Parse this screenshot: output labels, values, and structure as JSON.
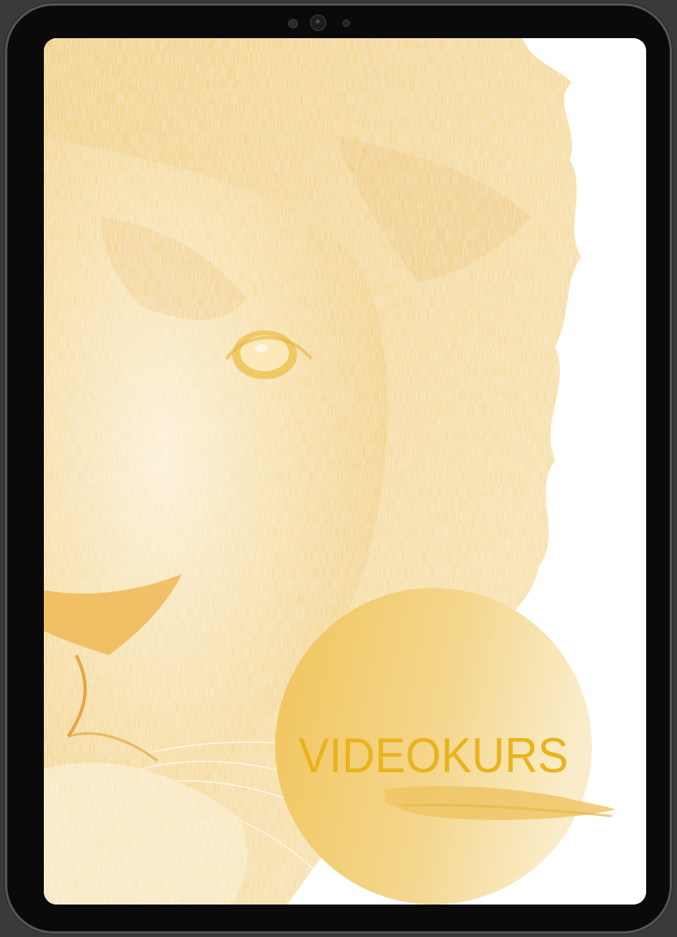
{
  "screen": {
    "badge_label": "VIDEOKURS"
  },
  "colors": {
    "accent": "#e9b31d",
    "lion_tint": "#f3cf76",
    "badge_gold": "#f0cd73",
    "frame": "#0a0a0a"
  },
  "image": {
    "subject_icon": "lion-face-illustration"
  }
}
